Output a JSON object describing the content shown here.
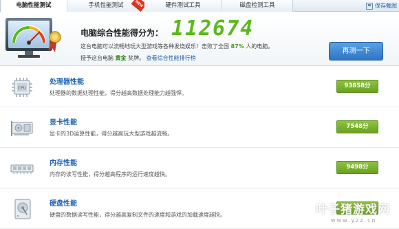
{
  "tabs": [
    {
      "label": "电脑性能测试",
      "active": true
    },
    {
      "label": "手机性能测试",
      "active": false,
      "badge": "NEW"
    },
    {
      "label": "硬件测试工具",
      "active": false
    },
    {
      "label": "磁盘检测工具",
      "active": false
    }
  ],
  "save": {
    "label": "保存截图",
    "icon": "save-icon"
  },
  "summary": {
    "title": "电脑综合性能得分为：",
    "score": "112674",
    "description_prefix": "这台电脑可以流畅地玩大型游戏等各种发烧娱乐！击败了全国",
    "beat_percent": "87%",
    "description_suffix": "人的电脑。",
    "award_prefix": "授予这台电脑",
    "award_level": "黄金",
    "award_suffix": "奖牌。",
    "rank_link": "查看综合性能排行榜",
    "retest_label": "再测一下"
  },
  "rows": [
    {
      "title": "处理器性能",
      "desc": "处理器的数据处理性能，得分越高数据处理能力越强悍。",
      "score": "93858分",
      "icon": "cpu-icon"
    },
    {
      "title": "显卡性能",
      "desc": "显卡的3D运算性能，得分越高玩大型游戏越流畅。",
      "score": "7548分",
      "icon": "graphics-card-icon"
    },
    {
      "title": "内存性能",
      "desc": "内存的读写性能，得分越高程序的运行速度越快。",
      "score": "9498分",
      "icon": "memory-icon"
    },
    {
      "title": "硬盘性能",
      "desc": "硬盘的数据读写性能，得分越高复制文件的速度和游戏的加载速度越快。",
      "score": "分",
      "icon": "hard-disk-icon"
    }
  ],
  "watermark": {
    "text": "叶子猪游戏网",
    "url": "www.yzz.cn"
  },
  "colors": {
    "accent": "#5bb91b",
    "link": "#1f64b0",
    "button": "#2e74c4",
    "score_badge": "#6aa121"
  }
}
